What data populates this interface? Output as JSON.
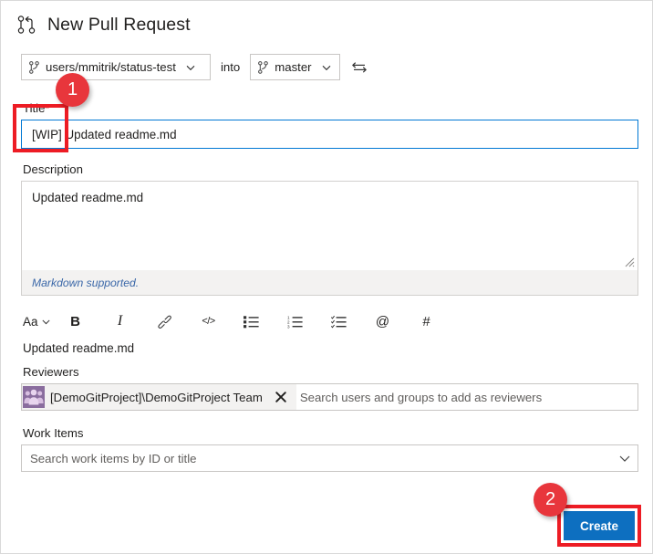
{
  "header": {
    "title": "New Pull Request",
    "icon": "pull-request-icon"
  },
  "branch_row": {
    "source_branch": "users/mmitrik/status-test",
    "into_label": "into",
    "target_branch": "master",
    "swap_icon": "swap-branches-icon",
    "branch_icon": "git-branch-icon",
    "chevron_icon": "chevron-down-icon"
  },
  "title_field": {
    "label": "Title",
    "required_marker": "*",
    "value": "[WIP] Updated readme.md"
  },
  "description_field": {
    "label": "Description",
    "value": "Updated readme.md",
    "footer_note": "Markdown supported."
  },
  "markdown_toolbar": {
    "items": [
      {
        "name": "font-size-dropdown",
        "label": "Aa",
        "icon": "chevron-down-icon"
      },
      {
        "name": "bold-button",
        "label": "B",
        "icon": "bold-icon"
      },
      {
        "name": "italic-button",
        "label": "I",
        "icon": "italic-icon"
      },
      {
        "name": "link-button",
        "label": "",
        "icon": "link-icon"
      },
      {
        "name": "code-button",
        "label": "</>",
        "icon": "code-icon"
      },
      {
        "name": "bulleted-list-button",
        "label": "",
        "icon": "bulleted-list-icon"
      },
      {
        "name": "numbered-list-button",
        "label": "",
        "icon": "numbered-list-icon"
      },
      {
        "name": "task-list-button",
        "label": "",
        "icon": "task-list-icon"
      },
      {
        "name": "mention-button",
        "label": "@",
        "icon": "at-mention-icon"
      },
      {
        "name": "work-item-button",
        "label": "#",
        "icon": "hash-icon"
      }
    ]
  },
  "preview": {
    "text": "Updated readme.md"
  },
  "reviewers_field": {
    "label": "Reviewers",
    "placeholder": "Search users and groups to add as reviewers",
    "chips": [
      {
        "text": "[DemoGitProject]\\DemoGitProject Team",
        "avatar_icon": "group-avatar-icon",
        "remove_icon": "close-icon"
      }
    ]
  },
  "work_items_field": {
    "label": "Work Items",
    "placeholder": "Search work items by ID or title",
    "chevron_icon": "chevron-down-icon"
  },
  "actions": {
    "create_label": "Create"
  },
  "annotations": [
    {
      "number": "1",
      "target": "title-input-wip-prefix"
    },
    {
      "number": "2",
      "target": "create-button"
    }
  ],
  "colors": {
    "accent_blue": "#0d6fc0",
    "focus_border": "#0078d4",
    "annotation_red": "#ed1c24",
    "badge_red": "#e8363c",
    "link_blue": "#3a67a8",
    "avatar_purple": "#8a6d9e"
  }
}
